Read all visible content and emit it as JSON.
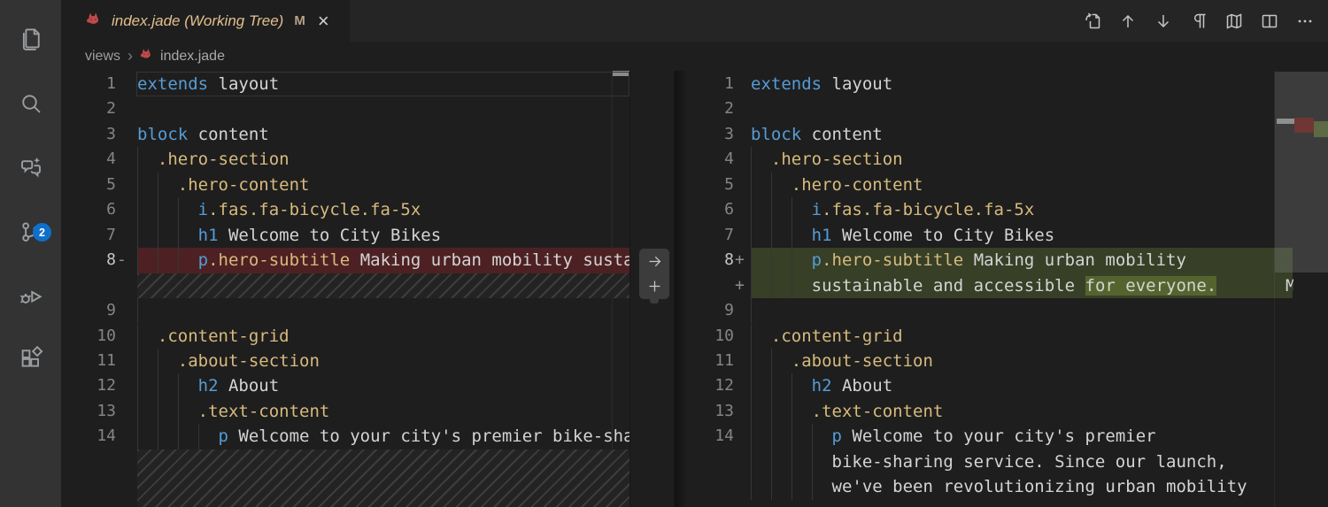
{
  "colors": {
    "editor_bg": "#1e1e1e",
    "activity_bar_bg": "#333333",
    "tab_bar_bg": "#252526",
    "badge_bg": "#0e70c9",
    "modified_text": "#e2c08d",
    "keyword": "#569cd6",
    "class_name": "#d7ba7d",
    "plain_text": "#d4d4d4",
    "deleted_line_bg": "#4d2123",
    "added_line_bg": "#373f27",
    "added_word_bg": "#55642e"
  },
  "activity_bar": {
    "items": [
      {
        "name": "explorer"
      },
      {
        "name": "search"
      },
      {
        "name": "chat"
      },
      {
        "name": "source-control",
        "badge": "2"
      },
      {
        "name": "run-and-debug"
      },
      {
        "name": "extensions"
      }
    ]
  },
  "tab_bar": {
    "tab": {
      "icon": "pug-file-icon",
      "title": "index.jade (Working Tree)",
      "modified_badge": "M",
      "close_label": "×"
    },
    "actions": [
      {
        "name": "open-file"
      },
      {
        "name": "previous-change"
      },
      {
        "name": "next-change"
      },
      {
        "name": "toggle-render-whitespace"
      },
      {
        "name": "map"
      },
      {
        "name": "split-editor"
      },
      {
        "name": "more-actions"
      }
    ]
  },
  "breadcrumb": {
    "folder": "views",
    "separator": "›",
    "file_icon": "pug-file-icon",
    "file": "index.jade"
  },
  "left_editor": {
    "rows": [
      {
        "n": "1",
        "cur": true,
        "t": [
          [
            "kw",
            "extends"
          ],
          [
            "pl",
            " layout"
          ]
        ]
      },
      {
        "n": "2",
        "t": []
      },
      {
        "n": "3",
        "t": [
          [
            "kw",
            "block"
          ],
          [
            "pl",
            " content"
          ]
        ]
      },
      {
        "n": "4",
        "g": 1,
        "t": [
          [
            "pl",
            "  "
          ],
          [
            "cls",
            ".hero-section"
          ]
        ]
      },
      {
        "n": "5",
        "g": 2,
        "t": [
          [
            "pl",
            "    "
          ],
          [
            "cls",
            ".hero-content"
          ]
        ]
      },
      {
        "n": "6",
        "g": 3,
        "t": [
          [
            "pl",
            "      "
          ],
          [
            "kw",
            "i"
          ],
          [
            "cls",
            ".fas.fa-bicycle.fa-5x"
          ]
        ]
      },
      {
        "n": "7",
        "g": 3,
        "t": [
          [
            "pl",
            "      "
          ],
          [
            "kw",
            "h1"
          ],
          [
            "pl",
            " Welcome to City Bikes"
          ]
        ]
      },
      {
        "n": "8",
        "sfx": "-",
        "bg": "del",
        "g": 3,
        "t": [
          [
            "pl",
            "      "
          ],
          [
            "kw",
            "p"
          ],
          [
            "cls",
            ".hero-subtitle"
          ],
          [
            "pl",
            " Making urban mobility susta"
          ]
        ]
      },
      {
        "hatch": true
      },
      {
        "n": "9",
        "g": 1,
        "t": []
      },
      {
        "n": "10",
        "g": 1,
        "t": [
          [
            "pl",
            "  "
          ],
          [
            "cls",
            ".content-grid"
          ]
        ]
      },
      {
        "n": "11",
        "g": 2,
        "t": [
          [
            "pl",
            "    "
          ],
          [
            "cls",
            ".about-section"
          ]
        ]
      },
      {
        "n": "12",
        "g": 3,
        "t": [
          [
            "pl",
            "      "
          ],
          [
            "kw",
            "h2"
          ],
          [
            "pl",
            " About"
          ]
        ]
      },
      {
        "n": "13",
        "g": 3,
        "t": [
          [
            "pl",
            "      "
          ],
          [
            "cls",
            ".text-content"
          ]
        ]
      },
      {
        "n": "14",
        "g": 4,
        "t": [
          [
            "pl",
            "        "
          ],
          [
            "kw",
            "p"
          ],
          [
            "pl",
            " Welcome to your city's premier bike-sha"
          ]
        ]
      },
      {
        "hatch": true,
        "tall": true
      }
    ]
  },
  "right_editor": {
    "edge_char": "M",
    "rows": [
      {
        "n": "1",
        "t": [
          [
            "kw",
            "extends"
          ],
          [
            "pl",
            " layout"
          ]
        ]
      },
      {
        "n": "2",
        "t": []
      },
      {
        "n": "3",
        "t": [
          [
            "kw",
            "block"
          ],
          [
            "pl",
            " content"
          ]
        ]
      },
      {
        "n": "4",
        "g": 1,
        "t": [
          [
            "pl",
            "  "
          ],
          [
            "cls",
            ".hero-section"
          ]
        ]
      },
      {
        "n": "5",
        "g": 2,
        "t": [
          [
            "pl",
            "    "
          ],
          [
            "cls",
            ".hero-content"
          ]
        ]
      },
      {
        "n": "6",
        "g": 3,
        "t": [
          [
            "pl",
            "      "
          ],
          [
            "kw",
            "i"
          ],
          [
            "cls",
            ".fas.fa-bicycle.fa-5x"
          ]
        ]
      },
      {
        "n": "7",
        "g": 3,
        "t": [
          [
            "pl",
            "      "
          ],
          [
            "kw",
            "h1"
          ],
          [
            "pl",
            " Welcome to City Bikes"
          ]
        ]
      },
      {
        "n": "8",
        "sfx": "+",
        "bg": "add",
        "g": 3,
        "t": [
          [
            "pl",
            "      "
          ],
          [
            "kw",
            "p"
          ],
          [
            "cls",
            ".hero-subtitle"
          ],
          [
            "pl",
            " Making urban mobility"
          ]
        ]
      },
      {
        "sfx": "+",
        "bg": "add",
        "g": 3,
        "edge": true,
        "t": [
          [
            "pl",
            "      "
          ],
          [
            "pl",
            "sustainable and accessible "
          ],
          [
            "hl",
            "for everyone."
          ]
        ]
      },
      {
        "n": "9",
        "g": 1,
        "t": []
      },
      {
        "n": "10",
        "g": 1,
        "t": [
          [
            "pl",
            "  "
          ],
          [
            "cls",
            ".content-grid"
          ]
        ]
      },
      {
        "n": "11",
        "g": 2,
        "t": [
          [
            "pl",
            "    "
          ],
          [
            "cls",
            ".about-section"
          ]
        ]
      },
      {
        "n": "12",
        "g": 3,
        "t": [
          [
            "pl",
            "      "
          ],
          [
            "kw",
            "h2"
          ],
          [
            "pl",
            " About"
          ]
        ]
      },
      {
        "n": "13",
        "g": 3,
        "t": [
          [
            "pl",
            "      "
          ],
          [
            "cls",
            ".text-content"
          ]
        ]
      },
      {
        "n": "14",
        "g": 4,
        "t": [
          [
            "pl",
            "        "
          ],
          [
            "kw",
            "p"
          ],
          [
            "pl",
            " Welcome to your city's premier"
          ]
        ]
      },
      {
        "g": 4,
        "t": [
          [
            "pl",
            "        "
          ],
          [
            "pl",
            "bike-sharing service. Since our launch,"
          ]
        ]
      },
      {
        "g": 4,
        "t": [
          [
            "pl",
            "        "
          ],
          [
            "pl",
            "we've been revolutionizing urban mobility"
          ]
        ]
      }
    ]
  },
  "minimap": {
    "marks": [
      {
        "name": "modified-mark",
        "color": "#8f8f8f"
      },
      {
        "name": "deleted-mark",
        "color": "#703634"
      },
      {
        "name": "added-mark",
        "color": "#5e6945"
      }
    ]
  }
}
